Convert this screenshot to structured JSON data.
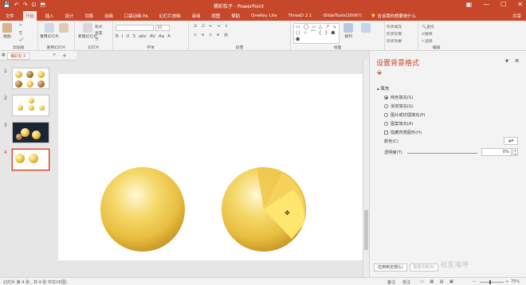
{
  "titlebar": {
    "title": "桶彩粒子 - PowerPoint",
    "qat": [
      "💾",
      "↶",
      "↷",
      "⊡",
      "⬒"
    ]
  },
  "tabs": [
    {
      "label": "文件"
    },
    {
      "label": "开始",
      "active": true
    },
    {
      "label": "插入"
    },
    {
      "label": "设计"
    },
    {
      "label": "切换"
    },
    {
      "label": "动画"
    },
    {
      "label": "口袋动画 PA"
    },
    {
      "label": "幻灯片放映"
    },
    {
      "label": "审阅"
    },
    {
      "label": "视图"
    },
    {
      "label": "帮助"
    },
    {
      "label": "OneKey Lite"
    },
    {
      "label": "ThreeD 2.1"
    },
    {
      "label": "iSlideTools(2006?)"
    }
  ],
  "tellme": "告诉我你想要做什么",
  "share": "共享",
  "ribbon": {
    "clipboard": {
      "paste": "粘贴",
      "label": "剪贴板"
    },
    "reuse": {
      "btn": "重用幻灯片",
      "label": "重用幻灯片",
      "tools": "新建动画库"
    },
    "slides": {
      "new": "新建幻灯片",
      "layout": "版式",
      "reset": "重置",
      "section": "节",
      "label": "幻灯片"
    },
    "font": {
      "label": "字体",
      "size": "10",
      "row": [
        "B",
        "I",
        "U",
        "S",
        "abc",
        "AV",
        "Aa",
        "A"
      ]
    },
    "paragraph": {
      "label": "段落"
    },
    "drawing": {
      "shapes": "▭ ◯ ▱ △ ↗ ↘ ⟨⟩ ☆ ⌒ { } ⬢ ⬟",
      "arrange": "排列",
      "label": "绘图",
      "quickstyle": "快速样式",
      "fill": "形状填充",
      "outline": "形状轮廓",
      "effects": "形状效果"
    },
    "editing": {
      "find": "查找",
      "replace": "替换",
      "select": "选择",
      "label": "编辑"
    }
  },
  "slides_panel": {
    "tab": "桶彩粒子",
    "thumbnails": [
      {
        "num": "1"
      },
      {
        "num": "2"
      },
      {
        "num": "3"
      },
      {
        "num": "4",
        "active": true
      }
    ]
  },
  "format_pane": {
    "title": "设置背景格式",
    "section": "填充",
    "options": [
      {
        "label": "纯色填充(S)",
        "type": "radio",
        "on": true
      },
      {
        "label": "渐变填充(G)",
        "type": "radio"
      },
      {
        "label": "图片或纹理填充(P)",
        "type": "radio"
      },
      {
        "label": "图案填充(A)",
        "type": "radio"
      },
      {
        "label": "隐藏背景图形(H)",
        "type": "check"
      }
    ],
    "color_label": "颜色(C)",
    "transparency_label": "透明度(T)",
    "transparency_value": "0%",
    "apply_all": "应用到全部(L)",
    "reset_bg": "重置背景(B)"
  },
  "status": {
    "slide": "幻灯片 第 4 张，共 4 张",
    "lang": "中文(中国)",
    "notes": "备注",
    "comments": "批注",
    "zoom": "75%"
  },
  "watermark": "社区喵呼",
  "colors": {
    "accent": "#c7472a",
    "gold": "#e8be3f"
  }
}
